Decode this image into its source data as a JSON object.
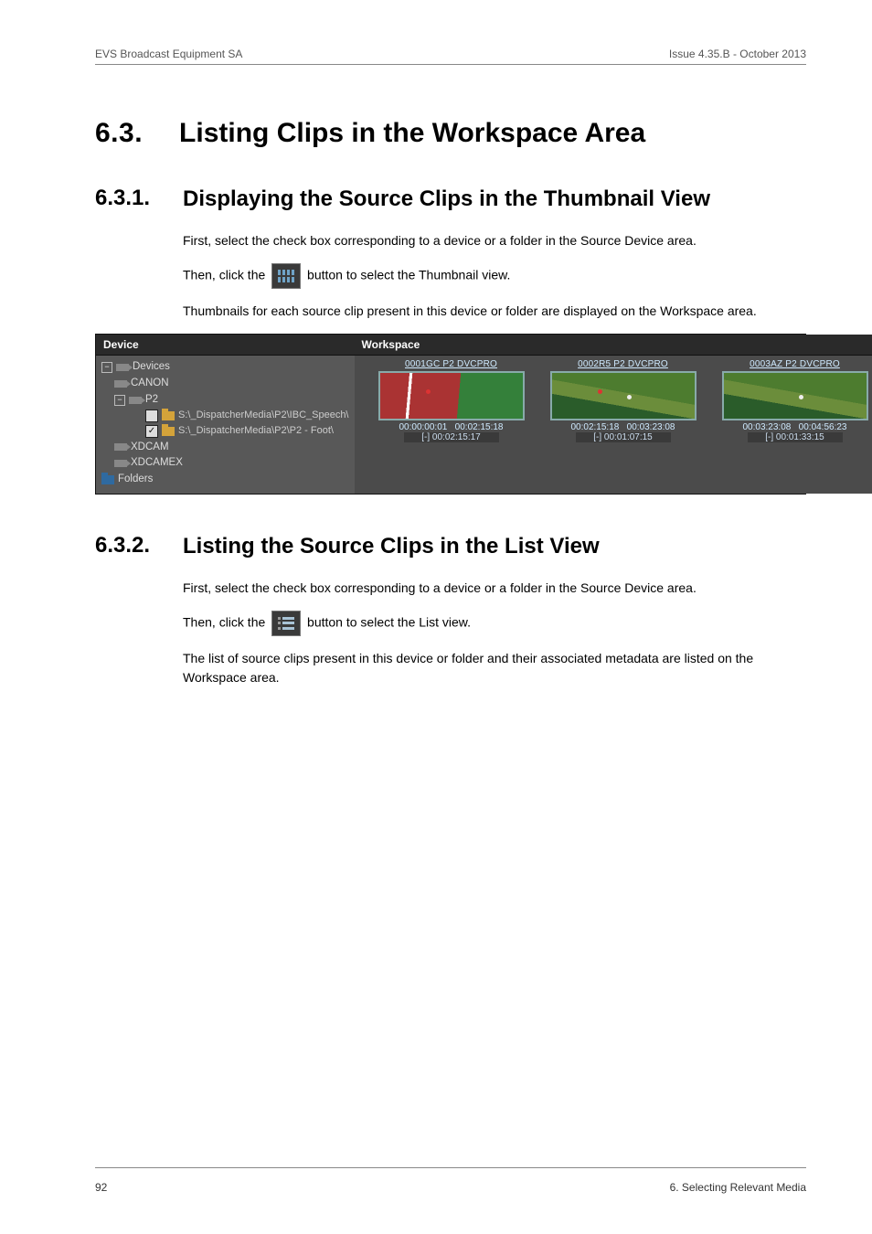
{
  "header": {
    "left": "EVS Broadcast Equipment SA",
    "right": "Issue 4.35.B - October 2013"
  },
  "h1": {
    "num": "6.3.",
    "text": "Listing Clips in the Workspace Area"
  },
  "s631": {
    "num": "6.3.1.",
    "text": "Displaying the Source Clips in the Thumbnail View",
    "p1": "First, select the check box corresponding to a device or a folder in the Source Device area.",
    "p2a": "Then, click the ",
    "p2b": " button to select the Thumbnail view.",
    "p3": "Thumbnails for each source clip present in this device or folder are displayed on the Workspace area."
  },
  "figure": {
    "col_device": "Device",
    "col_workspace": "Workspace",
    "tree": {
      "devices": "Devices",
      "canon": "CANON",
      "p2": "P2",
      "path1_label": "S:\\_DispatcherMedia\\P2\\IBC_Speech\\",
      "path2_label": "S:\\_DispatcherMedia\\P2\\P2 - Foot\\",
      "xdcam": "XDCAM",
      "xdcamex": "XDCAMEX",
      "folders": "Folders"
    },
    "thumbs": [
      {
        "title": "0001GC P2 DVCPRO",
        "tc": "00:00:00:01   00:02:15:18",
        "dur": "[-] 00:02:15:17"
      },
      {
        "title": "0002R5 P2 DVCPRO",
        "tc": "00:02:15:18   00:03:23:08",
        "dur": "[-] 00:01:07:15"
      },
      {
        "title": "0003AZ P2 DVCPRO",
        "tc": "00:03:23:08   00:04:56:23",
        "dur": "[-] 00:01:33:15"
      }
    ]
  },
  "s632": {
    "num": "6.3.2.",
    "text": "Listing the Source Clips in the List View",
    "p1": "First, select the check box corresponding to a device or a folder in the Source Device area.",
    "p2a": "Then, click the ",
    "p2b": " button to select the List view.",
    "p3": "The list of source clips present in this device or folder and their associated metadata are listed on the Workspace area."
  },
  "footer": {
    "page": "92",
    "section": "6. Selecting Relevant Media"
  }
}
